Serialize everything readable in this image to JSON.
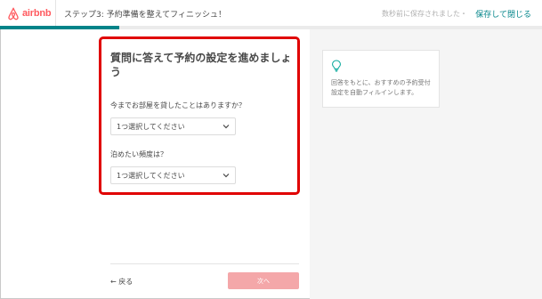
{
  "brand": {
    "name": "airbnb",
    "color": "#ff5a5f"
  },
  "header": {
    "step_title": "ステップ3: 予約準備を整えてフィニッシュ！",
    "save_status": "数秒前に保存されました",
    "separator": "・",
    "save_close": "保存して閉じる"
  },
  "progress": {
    "fraction": 0.22,
    "color": "#008489"
  },
  "main": {
    "title": "質問に答えて予約の設定を進めましょう",
    "q1": {
      "label": "今までお部屋を貸したことはありますか？",
      "value": "1つ選択してください"
    },
    "q2": {
      "label": "泊めたい頻度は？",
      "value": "1つ選択してください"
    }
  },
  "tip": {
    "icon": "lightbulb-icon",
    "text": "回答をもとに、おすすめの予約受付設定を自動フィルインします。"
  },
  "footer": {
    "back": "← 戻る",
    "next": "次へ"
  }
}
